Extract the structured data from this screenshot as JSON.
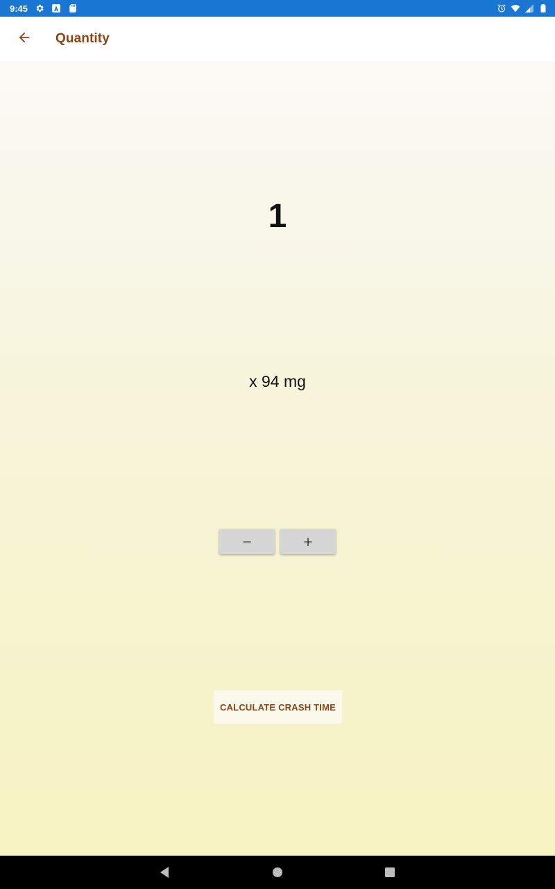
{
  "status_bar": {
    "time": "9:45",
    "left_icons": [
      "gear-icon",
      "a-badge-icon",
      "sd-card-icon"
    ],
    "right_icons": [
      "alarm-icon",
      "wifi-icon",
      "signal-icon",
      "battery-icon"
    ]
  },
  "app_bar": {
    "title": "Quantity",
    "back_icon": "arrow-left-icon",
    "accent_color": "#8b4513"
  },
  "main": {
    "quantity": "1",
    "dose_label": "x 94 mg",
    "decrement_label": "−",
    "increment_label": "+",
    "calculate_label": "CALCULATE CRASH TIME"
  },
  "nav_bar": {
    "icons": [
      "back-triangle-icon",
      "home-circle-icon",
      "recents-square-icon"
    ]
  },
  "colors": {
    "status_bar": "#1976d2",
    "accent": "#8b4513",
    "background_top": "#fbfaf6",
    "background_bottom": "#f7f3c2",
    "button_gray": "#d6d6d6"
  }
}
